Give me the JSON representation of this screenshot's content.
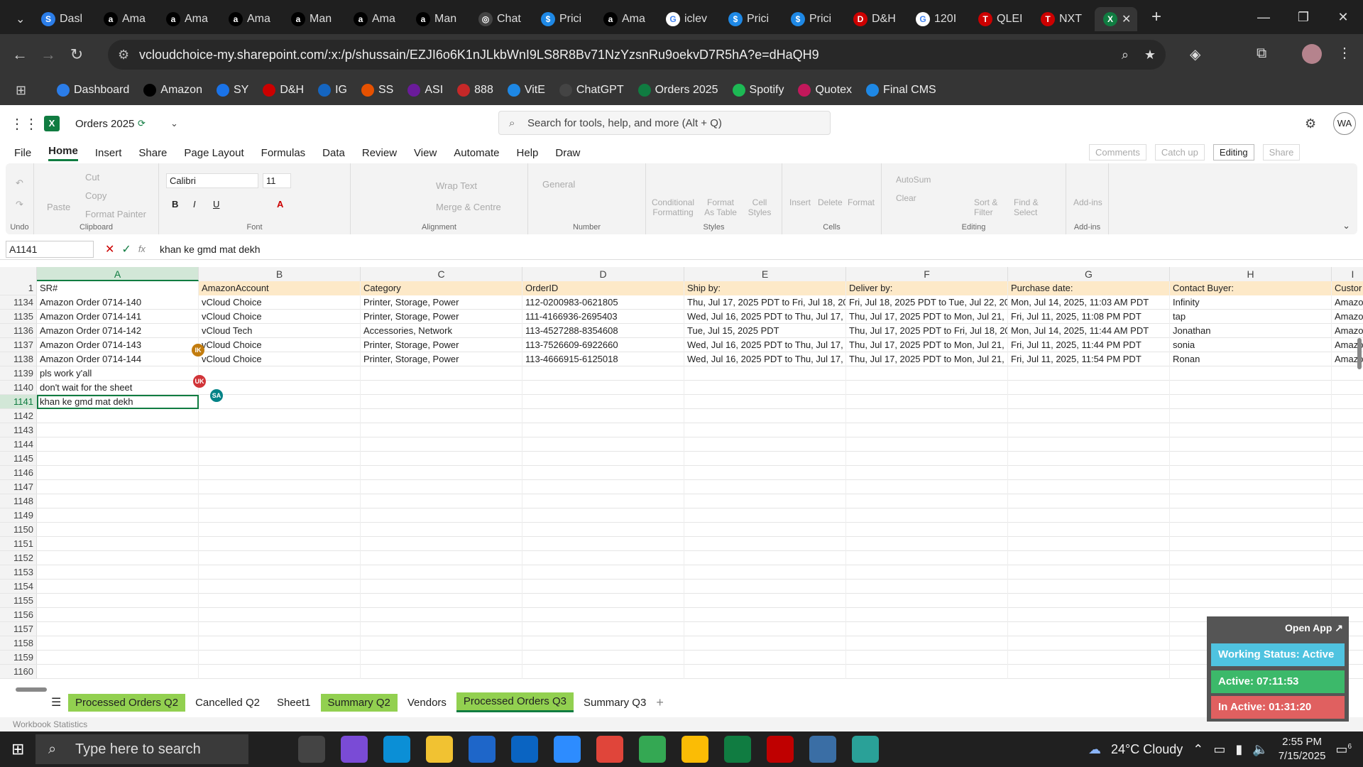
{
  "browser": {
    "tabs": [
      {
        "label": "Dasl",
        "color": "#2b7de9",
        "glyph": "S"
      },
      {
        "label": "Ama",
        "color": "#000",
        "glyph": "a"
      },
      {
        "label": "Ama",
        "color": "#000",
        "glyph": "a"
      },
      {
        "label": "Ama",
        "color": "#000",
        "glyph": "a"
      },
      {
        "label": "Man",
        "color": "#000",
        "glyph": "a"
      },
      {
        "label": "Ama",
        "color": "#000",
        "glyph": "a"
      },
      {
        "label": "Man",
        "color": "#000",
        "glyph": "a"
      },
      {
        "label": "Chat",
        "color": "#444",
        "glyph": "◎"
      },
      {
        "label": "Prici",
        "color": "#1e88e5",
        "glyph": "$"
      },
      {
        "label": "Ama",
        "color": "#000",
        "glyph": "a"
      },
      {
        "label": "iclev",
        "color": "#fff",
        "glyph": "G"
      },
      {
        "label": "Prici",
        "color": "#1e88e5",
        "glyph": "$"
      },
      {
        "label": "Prici",
        "color": "#1e88e5",
        "glyph": "$"
      },
      {
        "label": "D&H",
        "color": "#c00",
        "glyph": "D"
      },
      {
        "label": "120I",
        "color": "#fff",
        "glyph": "G"
      },
      {
        "label": "QLEI",
        "color": "#c00",
        "glyph": "T"
      },
      {
        "label": "NXT",
        "color": "#c00",
        "glyph": "T"
      }
    ],
    "active_tab_glyph": "X",
    "url": "vcloudchoice-my.sharepoint.com/:x:/p/shussain/EZJI6o6K1nJLkbWnI9LS8R8Bv71NzYzsnRu9oekvD7R5hA?e=dHaQH9",
    "bookmarks": [
      {
        "label": "Dashboard",
        "color": "#2b7de9"
      },
      {
        "label": "Amazon",
        "color": "#000"
      },
      {
        "label": "SY",
        "color": "#1a73e8"
      },
      {
        "label": "D&H",
        "color": "#c00"
      },
      {
        "label": "IG",
        "color": "#1565c0"
      },
      {
        "label": "SS",
        "color": "#e65100"
      },
      {
        "label": "ASI",
        "color": "#6a1b9a"
      },
      {
        "label": "888",
        "color": "#c62828"
      },
      {
        "label": "VitE",
        "color": "#1e88e5"
      },
      {
        "label": "ChatGPT",
        "color": "#444"
      },
      {
        "label": "Orders 2025",
        "color": "#107c41"
      },
      {
        "label": "Spotify",
        "color": "#1db954"
      },
      {
        "label": "Quotex",
        "color": "#c2185b"
      },
      {
        "label": "Final CMS",
        "color": "#1e88e5"
      }
    ]
  },
  "excel": {
    "file_name": "Orders 2025",
    "search_placeholder": "Search for tools, help, and more (Alt + Q)",
    "user_initials": "WA",
    "menu": [
      "File",
      "Home",
      "Insert",
      "Share",
      "Page Layout",
      "Formulas",
      "Data",
      "Review",
      "View",
      "Automate",
      "Help",
      "Draw"
    ],
    "active_menu": "Home",
    "right_buttons": {
      "comments": "Comments",
      "catchup": "Catch up",
      "editing": "Editing",
      "share": "Share"
    },
    "ribbon": {
      "undo": "Undo",
      "clipboard": {
        "paste": "Paste",
        "cut": "Cut",
        "copy": "Copy",
        "format_painter": "Format Painter",
        "caption": "Clipboard"
      },
      "font": {
        "name": "Calibri",
        "size": "11",
        "caption": "Font"
      },
      "alignment": {
        "wrap": "Wrap Text",
        "merge": "Merge & Centre",
        "caption": "Alignment"
      },
      "number": {
        "format": "General",
        "caption": "Number"
      },
      "styles": {
        "conditional": "Conditional Formatting",
        "table": "Format As Table",
        "cell": "Cell Styles",
        "caption": "Styles"
      },
      "cells": {
        "insert": "Insert",
        "delete": "Delete",
        "format": "Format",
        "caption": "Cells"
      },
      "editing": {
        "autosum": "AutoSum",
        "clear": "Clear",
        "sort": "Sort & Filter",
        "find": "Find & Select",
        "caption": "Editing"
      },
      "addins": {
        "label": "Add-ins",
        "caption": "Add-ins"
      }
    },
    "name_box": "A1141",
    "formula": "khan ke gmd mat dekh",
    "columns": [
      "A",
      "B",
      "C",
      "D",
      "E",
      "F",
      "G",
      "H",
      "I"
    ],
    "header_row": {
      "num": "1",
      "cells": [
        "SR#",
        "AmazonAccount",
        "Category",
        "OrderID",
        "Ship by:",
        "Deliver by:",
        "Purchase date:",
        "Contact Buyer:",
        "Custor"
      ]
    },
    "rows": [
      {
        "num": "1134",
        "cells": [
          "Amazon Order 0714-140",
          "vCloud Choice",
          "Printer, Storage, Power",
          "112-0200983-0621805",
          "Thu, Jul 17, 2025 PDT to Fri, Jul 18, 20",
          "Fri, Jul 18, 2025 PDT to Tue, Jul 22, 20",
          "Mon, Jul 14, 2025, 11:03 AM PDT",
          "Infinity",
          "Amazo"
        ]
      },
      {
        "num": "1135",
        "cells": [
          "Amazon Order 0714-141",
          "vCloud Choice",
          "Printer, Storage, Power",
          "111-4166936-2695403",
          "Wed, Jul 16, 2025 PDT to Thu, Jul 17, :",
          "Thu, Jul 17, 2025 PDT to Mon, Jul 21, :",
          "Fri, Jul 11, 2025, 11:08 PM PDT",
          "tap",
          "Amazo"
        ]
      },
      {
        "num": "1136",
        "cells": [
          "Amazon Order 0714-142",
          "vCloud Tech",
          "Accessories, Network",
          "113-4527288-8354608",
          "Tue, Jul 15, 2025 PDT",
          "Thu, Jul 17, 2025 PDT to Fri, Jul 18, 20",
          "Mon, Jul 14, 2025, 11:44 AM PDT",
          "Jonathan",
          "Amazo"
        ]
      },
      {
        "num": "1137",
        "cells": [
          "Amazon Order 0714-143",
          "vCloud Choice",
          "Printer, Storage, Power",
          "113-7526609-6922660",
          "Wed, Jul 16, 2025 PDT to Thu, Jul 17, :",
          "Thu, Jul 17, 2025 PDT to Mon, Jul 21, :",
          "Fri, Jul 11, 2025, 11:44 PM PDT",
          "sonia",
          "Amazo"
        ]
      },
      {
        "num": "1138",
        "cells": [
          "Amazon Order 0714-144",
          "vCloud Choice",
          "Printer, Storage, Power",
          "113-4666915-6125018",
          "Wed, Jul 16, 2025 PDT to Thu, Jul 17, :",
          "Thu, Jul 17, 2025 PDT to Mon, Jul 21, :",
          "Fri, Jul 11, 2025, 11:54 PM PDT",
          "Ronan",
          "Amazo"
        ]
      },
      {
        "num": "1139",
        "cells": [
          "pls work y'all",
          "",
          "",
          "",
          "",
          "",
          "",
          "",
          ""
        ]
      },
      {
        "num": "1140",
        "cells": [
          "don't wait for the sheet",
          "",
          "",
          "",
          "",
          "",
          "",
          "",
          ""
        ]
      },
      {
        "num": "1141",
        "cells": [
          "khan ke gmd mat dekh",
          "",
          "",
          "",
          "",
          "",
          "",
          "",
          ""
        ]
      },
      {
        "num": "1142",
        "cells": []
      },
      {
        "num": "1143",
        "cells": []
      },
      {
        "num": "1144",
        "cells": []
      },
      {
        "num": "1145",
        "cells": []
      },
      {
        "num": "1146",
        "cells": []
      },
      {
        "num": "1147",
        "cells": []
      },
      {
        "num": "1148",
        "cells": []
      },
      {
        "num": "1149",
        "cells": []
      },
      {
        "num": "1150",
        "cells": []
      },
      {
        "num": "1151",
        "cells": []
      },
      {
        "num": "1152",
        "cells": []
      },
      {
        "num": "1153",
        "cells": []
      },
      {
        "num": "1154",
        "cells": []
      },
      {
        "num": "1155",
        "cells": []
      },
      {
        "num": "1156",
        "cells": []
      },
      {
        "num": "1157",
        "cells": []
      },
      {
        "num": "1158",
        "cells": []
      },
      {
        "num": "1159",
        "cells": []
      },
      {
        "num": "1160",
        "cells": []
      }
    ],
    "collaborators": [
      {
        "initials": "IK",
        "color": "#c27c0e"
      },
      {
        "initials": "UK",
        "color": "#d13438"
      },
      {
        "initials": "SA",
        "color": "#038387"
      }
    ],
    "sheets": [
      {
        "label": "Processed Orders Q2",
        "green": true,
        "active": false
      },
      {
        "label": "Cancelled Q2",
        "green": false,
        "active": false
      },
      {
        "label": "Sheet1",
        "green": false,
        "active": false
      },
      {
        "label": "Summary Q2",
        "green": true,
        "active": false
      },
      {
        "label": "Vendors",
        "green": false,
        "active": false
      },
      {
        "label": "Processed Orders Q3",
        "green": true,
        "active": true
      },
      {
        "label": "Summary Q3",
        "green": false,
        "active": false
      }
    ],
    "status_text": "Workbook Statistics"
  },
  "widget": {
    "open_app": "Open App ↗",
    "working_status": "Working Status: Active",
    "active": "Active: 07:11:53",
    "inactive": "In Active: 01:31:20",
    "colors": {
      "working": "#4fc3e0",
      "active": "#3cb96a",
      "inactive": "#e06060"
    }
  },
  "taskbar": {
    "search_placeholder": "Type here to search",
    "weather": "24°C  Cloudy",
    "time": "2:55 PM",
    "date": "7/15/2025",
    "notifications": "6"
  }
}
